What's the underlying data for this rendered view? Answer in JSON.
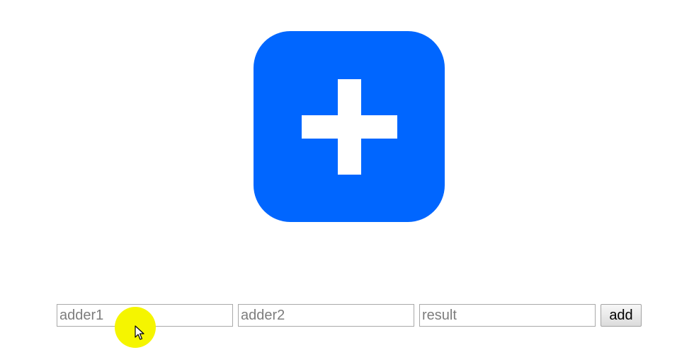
{
  "logo": {
    "icon": "plus-icon",
    "color": "#0066ff"
  },
  "form": {
    "adder1_placeholder": "adder1",
    "adder1_value": "",
    "adder2_placeholder": "adder2",
    "adder2_value": "",
    "result_placeholder": "result",
    "result_value": "",
    "add_label": "add"
  },
  "overlay": {
    "cursor_icon": "mouse-pointer-icon",
    "highlight_color": "#f5f500"
  }
}
